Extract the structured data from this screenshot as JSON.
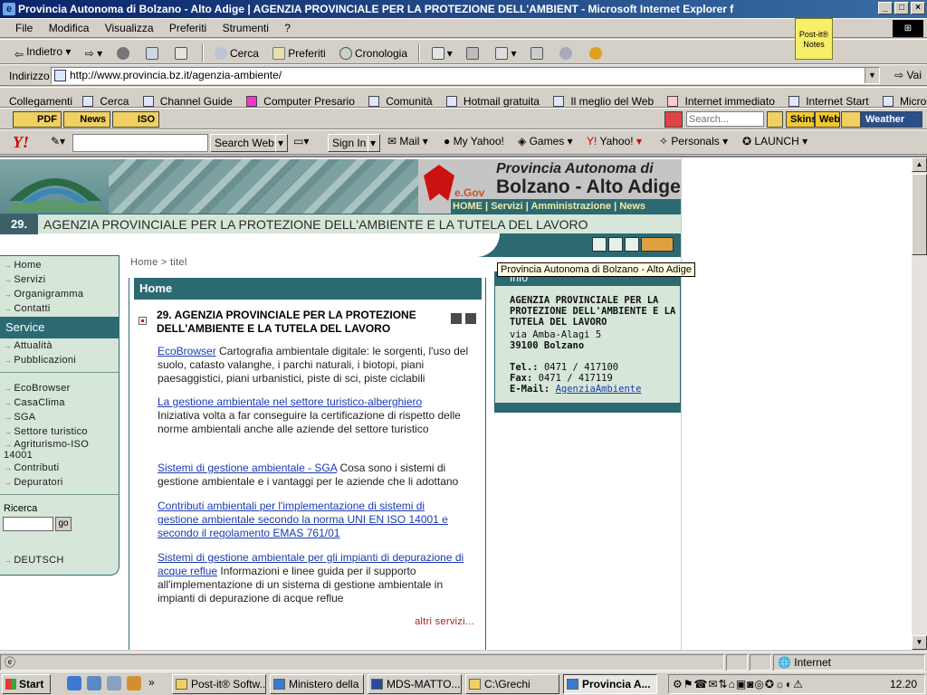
{
  "window": {
    "title": "Provincia Autonoma di Bolzano - Alto Adige | AGENZIA PROVINCIALE PER LA PROTEZIONE DELL'AMBIENT - Microsoft Internet Explorer f",
    "buttons": [
      "_",
      "□",
      "×"
    ]
  },
  "menu": [
    "File",
    "Modifica",
    "Visualizza",
    "Preferiti",
    "Strumenti",
    "?"
  ],
  "postit": {
    "label": "Post-it® Notes"
  },
  "toolbar": {
    "back": "Indietro",
    "search": "Cerca",
    "favorites": "Preferiti",
    "history": "Cronologia"
  },
  "address": {
    "label": "Indirizzo",
    "url": "http://www.provincia.bz.it/agenzia-ambiente/",
    "go": "Vai"
  },
  "links": {
    "label": "Collegamenti",
    "items": [
      "Cerca",
      "Channel Guide",
      "Computer Presario",
      "Comunità",
      "Hotmail gratuita",
      "Il meglio del Web",
      "Internet immediato",
      "Internet Start",
      "Microsoft"
    ]
  },
  "ext": {
    "pdf": "PDF",
    "news": "News",
    "iso": "ISO",
    "search_placeholder": "Search...",
    "skins": "Skins",
    "web": "Web",
    "weather": "Weather"
  },
  "yahoo": {
    "logo": "Y!",
    "search_web": "Search Web",
    "sign_in": "Sign In",
    "items": [
      "Mail",
      "My Yahoo!",
      "Games",
      "Yahoo!",
      "Personals",
      "LAUNCH"
    ]
  },
  "page": {
    "banner": {
      "egov": "e.Gov",
      "prov_line1": "Provincia Autonoma di",
      "prov_line2": "Bolzano - Alto Adige",
      "nav": [
        "HOME",
        "Servizi",
        "Amministrazione",
        "News"
      ]
    },
    "agency": {
      "num": "29.",
      "name": "AGENZIA PROVINCIALE PER LA PROTEZIONE DELL'AMBIENTE E LA TUTELA DEL LAVORO"
    },
    "breadcrumb": "Home >  titel",
    "tooltip": "Provincia Autonoma di Bolzano - Alto Adige",
    "leftnav": {
      "top": [
        "Home",
        "Servizi",
        "Organigramma",
        "Contatti"
      ],
      "service_label": "Service",
      "service": [
        "Attualità",
        "Pubblicazioni"
      ],
      "topics": [
        "EcoBrowser",
        "CasaClima",
        "SGA",
        "Settore turistico",
        "Agriturismo-ISO 14001",
        "Contributi",
        "Depuratori"
      ],
      "search_label": "Ricerca",
      "search_go": "go",
      "lang": "DEUTSCH"
    },
    "main": {
      "header": "Home",
      "title": "29. AGENZIA PROVINCIALE PER LA PROTEZIONE DELL'AMBIENTE E LA TUTELA DEL LAVORO",
      "entries": [
        {
          "link": "EcoBrowser",
          "text": " Cartografia ambientale digitale: le sorgenti, l'uso del suolo, catasto valanghe, i parchi naturali, i biotopi, piani paesaggistici, piani urbanistici, piste di sci, piste ciclabili"
        },
        {
          "link": "La gestione ambientale nel settore turistico-alberghiero",
          "text": " Iniziativa volta a far conseguire la certificazione di rispetto delle norme ambientali anche alle aziende del settore turistico"
        },
        {
          "link": "Sistemi di gestione ambientale - SGA",
          "text": " Cosa sono i sistemi di gestione ambientale e i vantaggi per le aziende che li adottano"
        },
        {
          "link": "Contributi ambientali per l'implementazione di sistemi di gestione ambientale secondo la norma UNI EN ISO 14001 e secondo il regolamento EMAS 761/01",
          "text": ""
        },
        {
          "link": "Sistemi di gestione ambientale per gli impianti di depurazione di acque reflue",
          "text": " Informazioni e linee guida per il supporto all'implementazione di un sistema di gestione ambientale in impianti di depurazione di acque reflue"
        }
      ],
      "more": "altri servizi..."
    },
    "info": {
      "header": "Info",
      "org": "AGENZIA PROVINCIALE PER LA PROTEZIONE DELL'AMBIENTE E LA TUTELA DEL LAVORO",
      "street": "via Amba-Alagi 5",
      "city": "39100 Bolzano",
      "tel_label": "Tel.:",
      "tel": "0471 / 417100",
      "fax_label": "Fax:",
      "fax": "0471 / 417119",
      "email_label": "E-Mail:",
      "email": "AgenziaAmbiente"
    }
  },
  "status": {
    "zone": "Internet"
  },
  "taskbar": {
    "start": "Start",
    "tasks": [
      "Post-it® Softw...",
      "Ministero della ...",
      "MDS-MATTO...",
      "C:\\Grechi",
      "Provincia A..."
    ],
    "clock": "12.20"
  },
  "colors": {
    "teal": "#2c6a72",
    "mint": "#d6e6d8",
    "link": "#1a3bb0",
    "titlebar": "#0a246a"
  }
}
